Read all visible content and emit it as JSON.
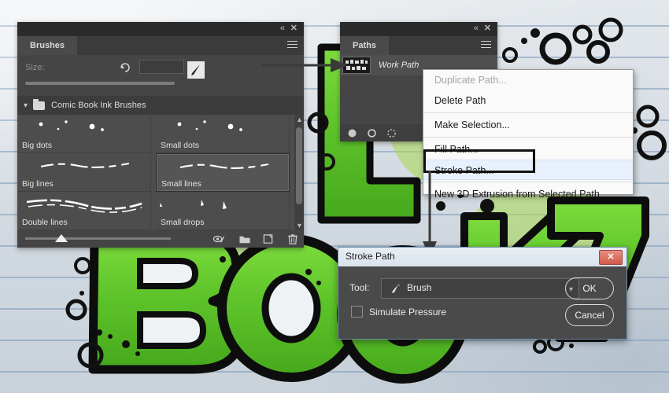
{
  "brushes_panel": {
    "tab_label": "Brushes",
    "collapse_icon": "double-chevron-left-icon",
    "close_icon": "close-icon",
    "menu_icon": "hamburger-menu-icon",
    "size_label": "Size:",
    "size_value": "",
    "reset_icon": "reset-arrow-icon",
    "preview_icon": "brush-preview-icon",
    "group_label": "Comic Book Ink Brushes",
    "group_chevron": "chevron-down-icon",
    "folder_icon": "folder-icon",
    "brushes": [
      {
        "name": "Big dots",
        "kind": "dots"
      },
      {
        "name": "Small dots",
        "kind": "dots"
      },
      {
        "name": "Big lines",
        "kind": "lines"
      },
      {
        "name": "Small lines",
        "kind": "lines",
        "selected": true
      },
      {
        "name": "Double lines",
        "kind": "double"
      },
      {
        "name": "Small drops",
        "kind": "drops"
      }
    ],
    "footer_icons": [
      "live-brush-tip-icon",
      "open-preset-folder-icon",
      "new-brush-icon",
      "delete-brush-icon"
    ]
  },
  "paths_panel": {
    "tab_label": "Paths",
    "collapse_icon": "double-chevron-left-icon",
    "close_icon": "close-icon",
    "menu_icon": "hamburger-menu-icon",
    "path_name": "Work Path",
    "footer_icons": [
      "fill-path-icon",
      "stroke-path-icon",
      "make-selection-icon"
    ]
  },
  "context_menu": {
    "items": [
      {
        "label": "Duplicate Path...",
        "disabled": true,
        "highlighted": false
      },
      {
        "label": "Delete Path",
        "disabled": false,
        "highlighted": false
      },
      {
        "label": "Make Selection...",
        "disabled": false,
        "highlighted": false
      },
      {
        "label": "Fill Path...",
        "disabled": false,
        "highlighted": false
      },
      {
        "label": "Stroke Path...",
        "disabled": false,
        "highlighted": true
      },
      {
        "label": "New 3D Extrusion from Selected Path",
        "disabled": false,
        "highlighted": false
      }
    ]
  },
  "stroke_dialog": {
    "title": "Stroke Path",
    "close_icon": "close-window-icon",
    "tool_label": "Tool:",
    "tool_value": "Brush",
    "tool_icon": "brush-icon",
    "caret_icon": "chevron-down-icon",
    "simulate_pressure_label": "Simulate Pressure",
    "simulate_pressure_checked": false,
    "ok_label": "OK",
    "cancel_label": "Cancel"
  },
  "annotations": {
    "highlight_target": "Stroke Path...",
    "arrow_to_path_thumbnail": "right-arrow-icon",
    "arrow_to_dialog": "down-arrow-icon"
  },
  "colors": {
    "panel_bg": "#454545",
    "panel_titlebar": "#2b2b2b",
    "tab_bg": "#4a4a4a",
    "menu_bg": "#fafafa",
    "menu_highlight": "#e8f1fb",
    "dialog_titlebar": "#dde6ee",
    "close_button": "#d2594a",
    "artwork_green": "#5ec42a",
    "paper_blue_line": "#7898b9"
  }
}
